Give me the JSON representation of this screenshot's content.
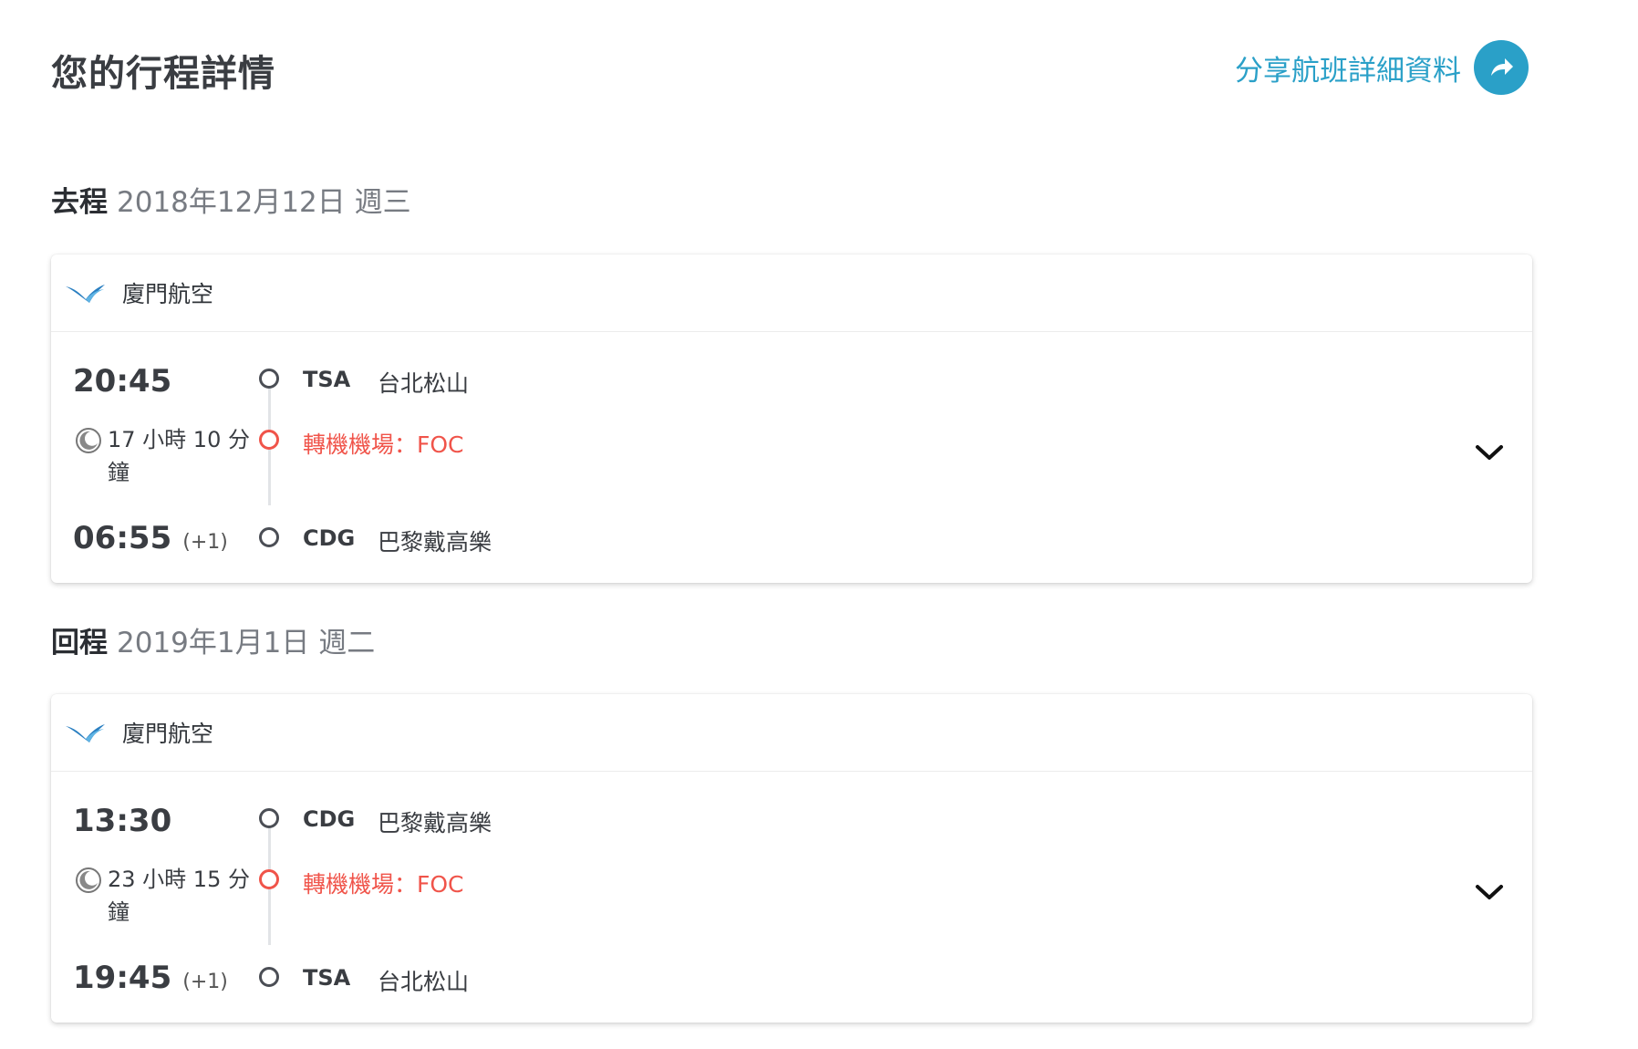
{
  "page": {
    "title": "您的行程詳情",
    "share_label": "分享航班詳細資料",
    "accent_color": "#2aa0c8",
    "transfer_color": "#f0544a"
  },
  "outbound": {
    "kind": "去程",
    "date": "2018年12月12日 週三",
    "airline": "廈門航空",
    "depart_time": "20:45",
    "depart_code": "TSA",
    "depart_city": "台北松山",
    "duration": "17 小時 10 分鐘",
    "transfer": "轉機機場：FOC",
    "arrive_time": "06:55",
    "arrive_offset": "(+1)",
    "arrive_code": "CDG",
    "arrive_city": "巴黎戴高樂"
  },
  "inbound": {
    "kind": "回程",
    "date": "2019年1月1日 週二",
    "airline": "廈門航空",
    "depart_time": "13:30",
    "depart_code": "CDG",
    "depart_city": "巴黎戴高樂",
    "duration": "23 小時 15 分鐘",
    "transfer": "轉機機場：FOC",
    "arrive_time": "19:45",
    "arrive_offset": "(+1)",
    "arrive_code": "TSA",
    "arrive_city": "台北松山"
  }
}
